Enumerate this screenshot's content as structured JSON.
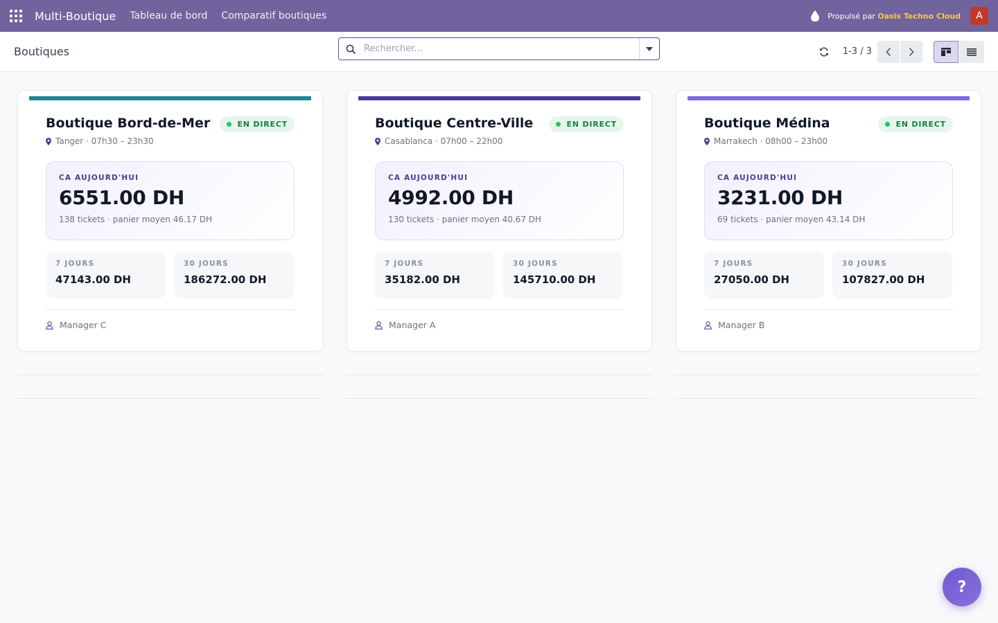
{
  "navbar": {
    "brand": "Multi-Boutique",
    "menus": [
      "Tableau de bord",
      "Comparatif boutiques"
    ],
    "powered_prefix": "Propulsé par",
    "powered_company": "Oasis Techno Cloud",
    "avatar_letter": "A",
    "bg_color": "#71639e"
  },
  "control_panel": {
    "breadcrumb": "Boutiques",
    "search_placeholder": "Rechercher...",
    "pager": "1-3 / 3"
  },
  "cards": [
    {
      "name": "Boutique Bord-de-Mer",
      "accent": "#1a8b96",
      "badge": "EN DIRECT",
      "location": "Tanger · 07h30 – 23h30",
      "today_label": "CA AUJOURD'HUI",
      "today_value": "6551.00 DH",
      "today_meta": "138 tickets · panier moyen 46.17 DH",
      "stat7_label": "7 JOURS",
      "stat7_value": "47143.00 DH",
      "stat30_label": "30 JOURS",
      "stat30_value": "186272.00 DH",
      "manager": "Manager C"
    },
    {
      "name": "Boutique Centre-Ville",
      "accent": "#4a3a9e",
      "badge": "EN DIRECT",
      "location": "Casablanca · 07h00 – 22h00",
      "today_label": "CA AUJOURD'HUI",
      "today_value": "4992.00 DH",
      "today_meta": "130 tickets · panier moyen 40.67 DH",
      "stat7_label": "7 JOURS",
      "stat7_value": "35182.00 DH",
      "stat30_label": "30 JOURS",
      "stat30_value": "145710.00 DH",
      "manager": "Manager A"
    },
    {
      "name": "Boutique Médina",
      "accent": "#7c68e0",
      "badge": "EN DIRECT",
      "location": "Marrakech · 08h00 – 23h00",
      "today_label": "CA AUJOURD'HUI",
      "today_value": "3231.00 DH",
      "today_meta": "69 tickets · panier moyen 43.14 DH",
      "stat7_label": "7 JOURS",
      "stat7_value": "27050.00 DH",
      "stat30_label": "30 JOURS",
      "stat30_value": "107827.00 DH",
      "manager": "Manager B"
    }
  ],
  "help_label": "?"
}
